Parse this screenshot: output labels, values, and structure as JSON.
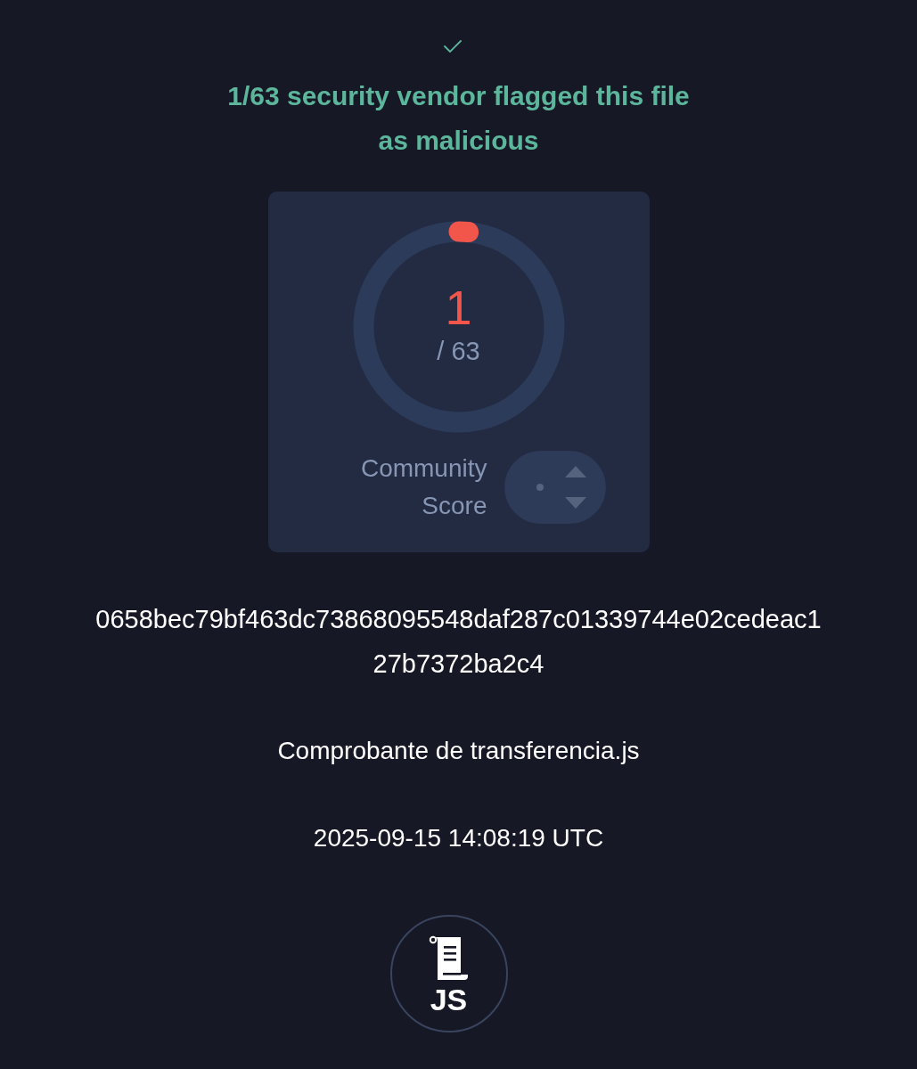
{
  "detection": {
    "title": "1/63 security vendor flagged this file as malicious"
  },
  "gauge": {
    "detected": "1",
    "total": "/ 63"
  },
  "community": {
    "label": "Community Score"
  },
  "file": {
    "hash": "0658bec79bf463dc73868095548daf287c01339744e02cedeac127b7372ba2c4",
    "name": "Comprobante de transferencia.js",
    "date": "2025-09-15 14:08:19 UTC",
    "type": "JS"
  }
}
